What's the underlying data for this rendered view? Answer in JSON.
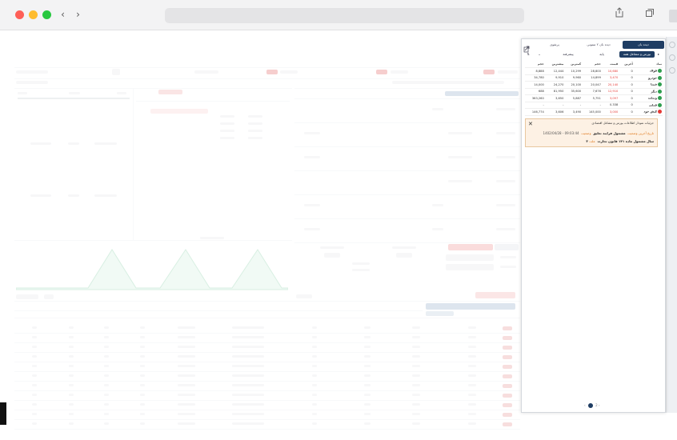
{
  "browser": {
    "back_label": "‹",
    "forward_label": "›",
    "share_icon": "share-icon",
    "tabs_icon": "tabs-icon"
  },
  "panel": {
    "tabs": [
      "دیده بان",
      "دیده بان ۲ ستونی",
      "پرتفوی"
    ],
    "subtabs": [
      "بورس و مشاغل همه",
      "پایه",
      "پیشرفته"
    ],
    "headers": [
      "نماد",
      "آخرین",
      "قیمت",
      "حجم",
      "کمترین",
      "بیشترین",
      "حجم"
    ],
    "rows": [
      {
        "name": "فولاد",
        "status": "green",
        "cells": [
          "0",
          "10,680",
          "28,800",
          "10,299",
          "12,444",
          "8,888"
        ],
        "neg": 1
      },
      {
        "name": "خودرو",
        "status": "green",
        "cells": [
          "0",
          "3,470",
          "14,899",
          "9,960",
          "9,910",
          "34,780"
        ],
        "neg": 1
      },
      {
        "name": "شپنا",
        "status": "green",
        "cells": [
          "0",
          "20,140",
          "20,047",
          "20,100",
          "24,270",
          "14,000"
        ],
        "neg": 1
      },
      {
        "name": "دیگر",
        "status": "green",
        "cells": [
          "0",
          "12,910",
          "7,676",
          "35,600",
          "81,950",
          "688"
        ],
        "neg": 1
      },
      {
        "name": "وبملت",
        "status": "green",
        "cells": [
          "0",
          "3,097",
          "5,751",
          "5,887",
          "3,650",
          "363,260"
        ],
        "neg": 1
      },
      {
        "name": "فملی",
        "status": "green",
        "cells": [
          "0",
          "0.338",
          "-",
          "-",
          "-",
          "-"
        ],
        "neg": 0
      },
      {
        "name": "کیش خود",
        "status": "red",
        "cells": [
          "0",
          "3,000",
          "145,000",
          "3,490",
          "3,606",
          "146,774"
        ],
        "neg": 1
      }
    ],
    "popup": {
      "tabs": "جزئیات  نمودار  اطلاعات  بورس و مشاغل اقتصادی",
      "line1_prefix": "وضعیت",
      "line1": "مشمول فرایند تعلیق",
      "line1_date_label": "تاریخ آخرین وضعیت",
      "line1_date": "1402/04/28 - 09:03:44",
      "line2_prefix": "علت",
      "line2": "۳ سال مشمول ماده ۱۴۱ قانون تجارت"
    },
    "pager": {
      "prev": "‹",
      "current": "1",
      "next": "2",
      "more": "›"
    }
  }
}
